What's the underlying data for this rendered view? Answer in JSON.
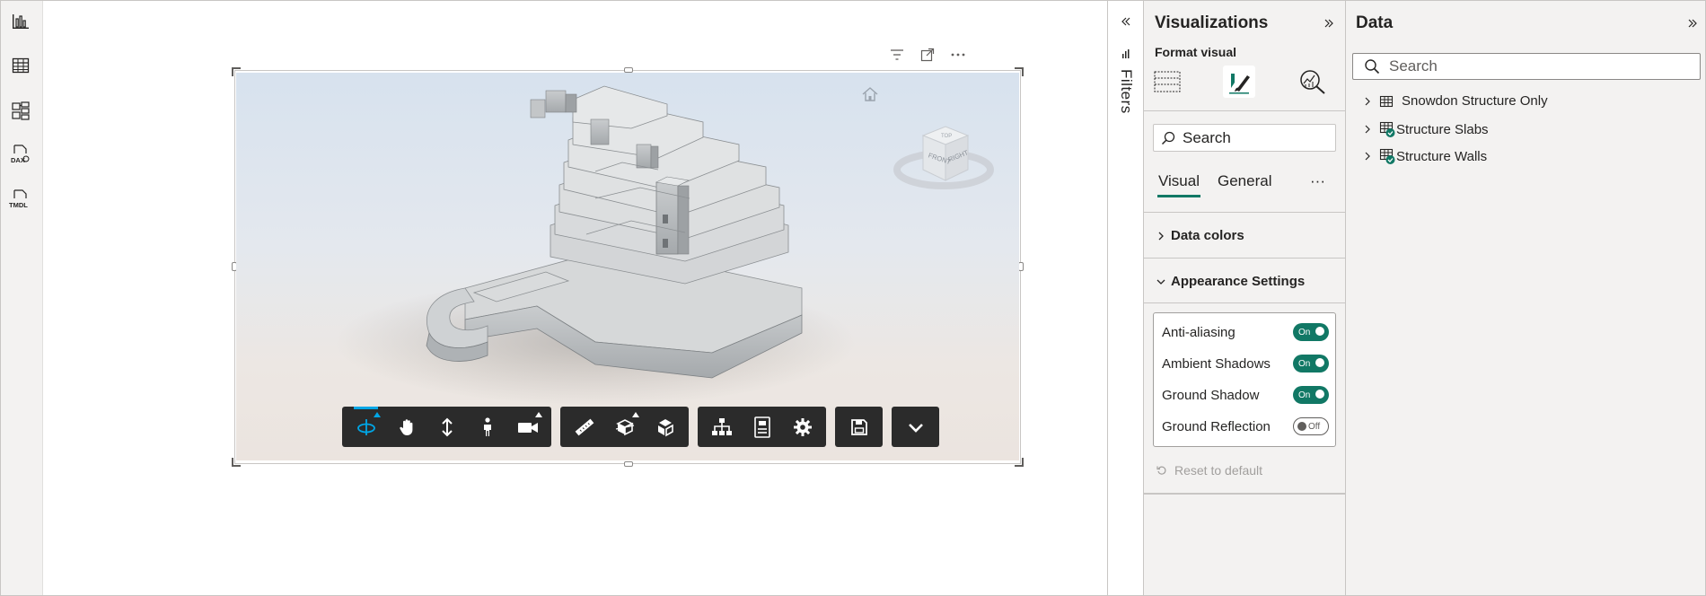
{
  "rail": {
    "icons": [
      "report-view-icon",
      "table-view-icon",
      "model-view-icon",
      "dax-query-view-icon",
      "tmdl-view-icon"
    ],
    "dax_label": "DAX",
    "tmdl_label": "TMDL"
  },
  "visual": {
    "header_icons": [
      "filter-icon",
      "focus-mode-icon",
      "more-options-icon"
    ],
    "toolbar": {
      "groups": [
        [
          "orbit-icon",
          "pan-icon",
          "zoom-icon",
          "first-person-icon",
          "camera-icon"
        ],
        [
          "measure-icon",
          "section-analysis-icon",
          "explode-model-icon"
        ],
        [
          "model-browser-icon",
          "properties-icon",
          "settings-icon"
        ],
        [
          "save-icon"
        ],
        [
          "chevron-down-icon"
        ]
      ]
    },
    "viewcube": {
      "front": "FRONT",
      "right": "RIGHT",
      "top": "TOP"
    }
  },
  "filters": {
    "label": "Filters"
  },
  "visualizations": {
    "title": "Visualizations",
    "subtitle": "Format visual",
    "search_placeholder": "Search",
    "tabs": {
      "visual": "Visual",
      "general": "General",
      "more": "···"
    },
    "sections": {
      "data_colors": "Data colors",
      "appearance": "Appearance Settings"
    },
    "settings": [
      {
        "label": "Anti-aliasing",
        "state": "On"
      },
      {
        "label": "Ambient Shadows",
        "state": "On"
      },
      {
        "label": "Ground Shadow",
        "state": "On"
      },
      {
        "label": "Ground Reflection",
        "state": "Off"
      }
    ],
    "reset_label": "Reset to default"
  },
  "data": {
    "title": "Data",
    "search_placeholder": "Search",
    "tables": [
      {
        "name": "Snowdon Structure Only",
        "checked": false
      },
      {
        "name": "Structure Slabs",
        "checked": true
      },
      {
        "name": "Structure Walls",
        "checked": true
      }
    ]
  },
  "colors": {
    "accent": "#117865",
    "active_tool": "#00a6e6",
    "toolbar_bg": "#2b2b2b"
  }
}
